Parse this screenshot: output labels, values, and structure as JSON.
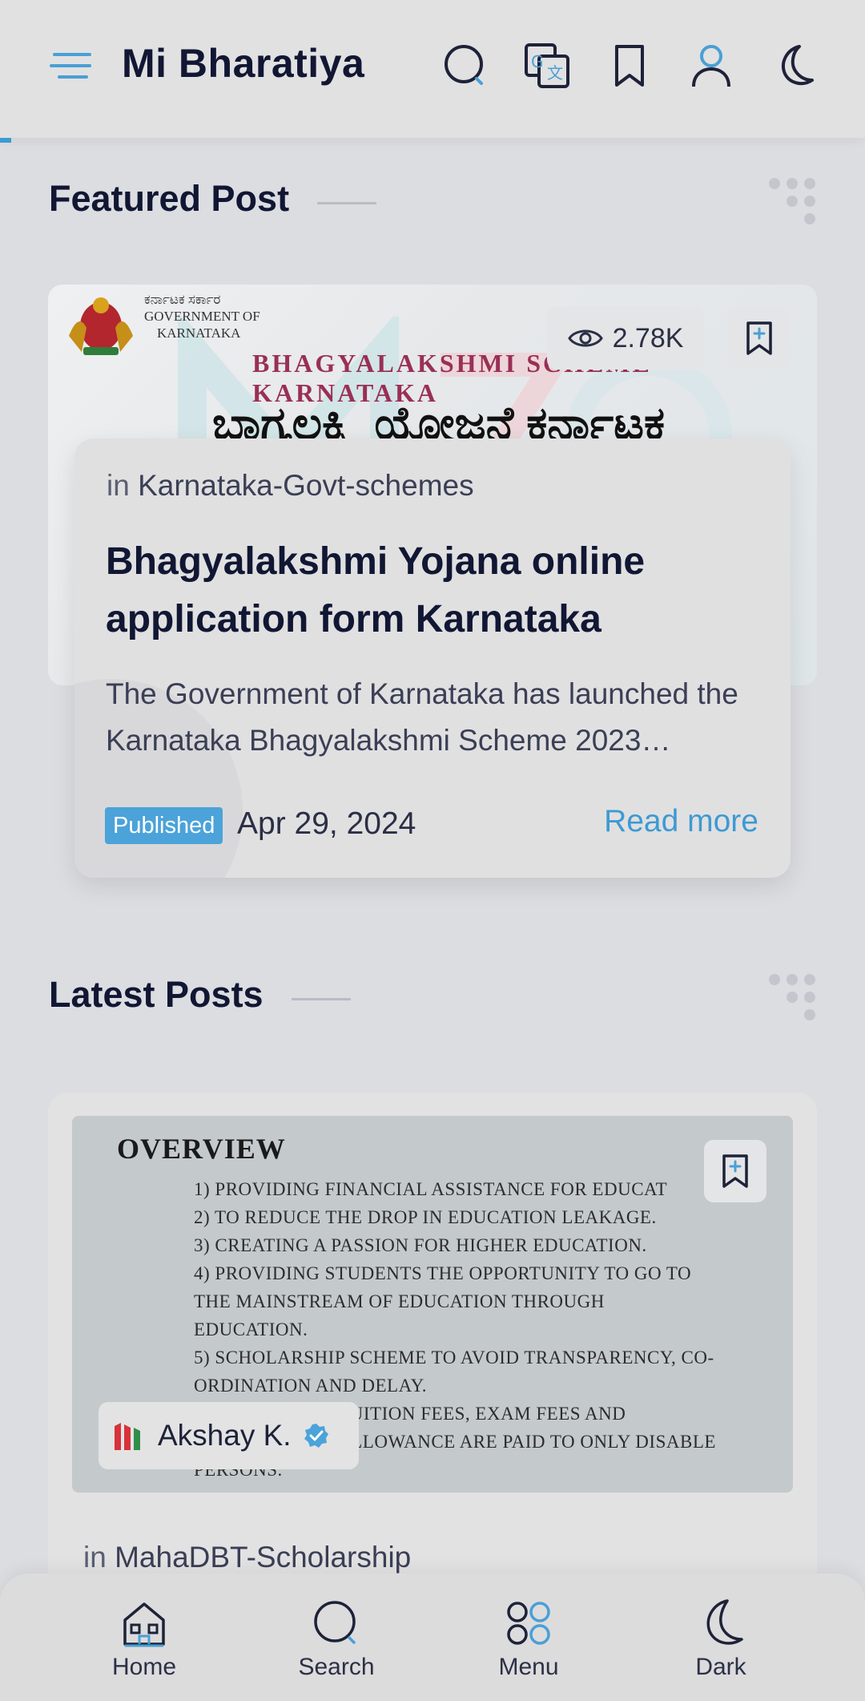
{
  "header": {
    "brand": "Mi Bharatiya",
    "icons": [
      "menu-icon",
      "search-icon",
      "translate-icon",
      "bookmark-icon",
      "user-icon",
      "moon-icon"
    ]
  },
  "featured": {
    "section_title": "Featured Post",
    "image_text": {
      "gov_line1": "ಕರ್ನಾಟಕ ಸರ್ಕಾರ",
      "gov_line2": "GOVERNMENT OF",
      "gov_line3": "KARNATAKA",
      "banner": "BHAGYALAKSHMI SCHEME KARNATAKA",
      "kannada_title": "ಬಾಗ್ಯಲಕ್ಷ್ಮಿ ಯೋಜನೆ ಕರ್ನಾಟಕ"
    },
    "views": "2.78K",
    "category_prefix": "in",
    "category": "Karnataka-Govt-schemes",
    "title": "Bhagyalakshmi Yojana online application form Karnataka",
    "description": "The Government of Karnataka has launched the Karnataka Bhagyalakshmi Scheme 2023…",
    "status": "Published",
    "date": "Apr 29, 2024",
    "read_more": "Read more"
  },
  "latest": {
    "section_title": "Latest Posts",
    "image_text": {
      "heading": "OVERVIEW",
      "lines": [
        "1) Providing financial assistance for educat",
        "2) To reduce the drop in education leakage.",
        "3) Creating a passion for higher education.",
        "4) Providing students the opportunity to go to",
        "the mainstream of education through",
        "education.",
        "5) Scholarship scheme to avoid transparency, co-",
        "ordination and delay.",
        "6) Benefits of tuition fees, exam fees and",
        "maintenance allowance are paid to only disable",
        "persons."
      ]
    },
    "author": "Akshay K.",
    "category_prefix": "in",
    "category": "MahaDBT-Scholarship"
  },
  "bottom_nav": [
    {
      "label": "Home",
      "icon": "home-icon"
    },
    {
      "label": "Search",
      "icon": "search-icon"
    },
    {
      "label": "Menu",
      "icon": "menu-grid-icon"
    },
    {
      "label": "Dark",
      "icon": "moon-icon"
    }
  ],
  "colors": {
    "accent": "#3d9ad3",
    "background": "#dcdde1",
    "title": "#111733",
    "badge": "#4ba3d9"
  }
}
